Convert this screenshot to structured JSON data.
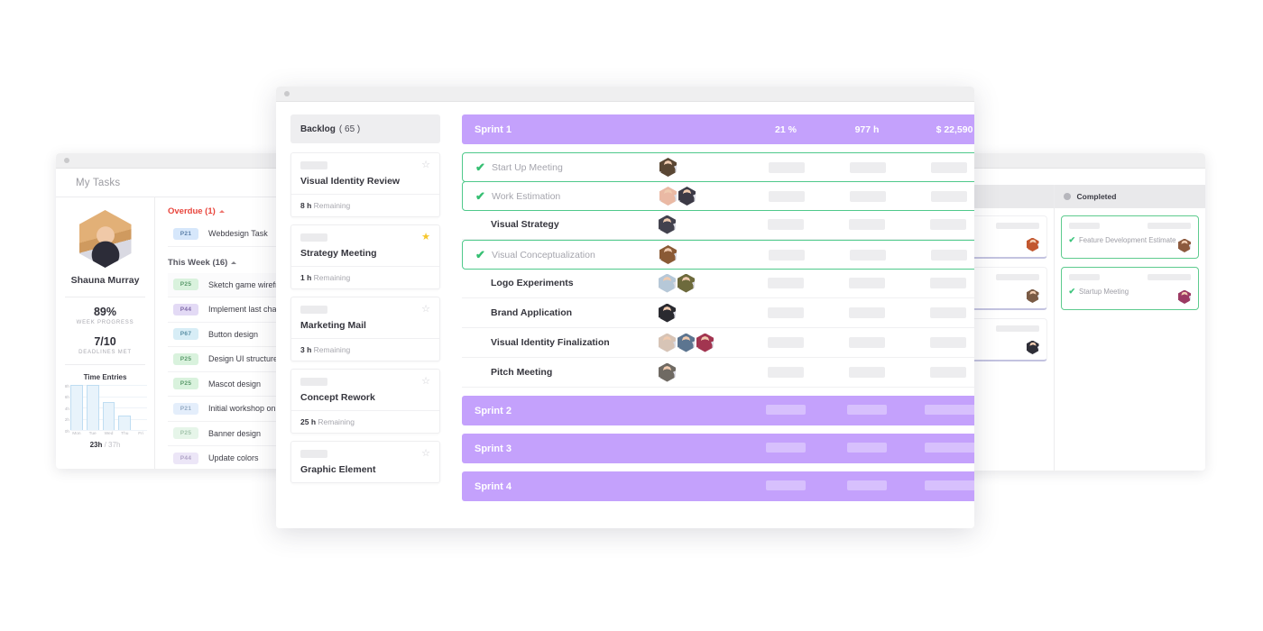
{
  "left_window": {
    "title": "My Tasks",
    "profile": {
      "name": "Shauna Murray",
      "stats": [
        {
          "value": "89%",
          "caption": "WEEK PROGRESS"
        },
        {
          "value": "7/10",
          "caption": "DEADLINES MET"
        }
      ],
      "time_total_done": "23h",
      "time_total_sep": " / ",
      "time_total_goal": "37h"
    },
    "groups": [
      {
        "label": "Overdue (1)",
        "kind": "overdue",
        "tasks": [
          {
            "tag": "P21",
            "tag_color": "#d6e7fb",
            "tag_text": "#5b7fa8",
            "name": "Webdesign Task",
            "shade": false
          }
        ]
      },
      {
        "label": "This Week (16)",
        "kind": "week",
        "tasks": [
          {
            "tag": "P25",
            "tag_color": "#d9f2dd",
            "tag_text": "#5a9a6b",
            "name": "Sketch game wireframes",
            "shade": true
          },
          {
            "tag": "P44",
            "tag_color": "#e3daf5",
            "tag_text": "#7f6aa8",
            "name": "Implement last changes",
            "shade": false
          },
          {
            "tag": "P67",
            "tag_color": "#d7edf6",
            "tag_text": "#5b90a5",
            "name": "Button design",
            "shade": false
          },
          {
            "tag": "P25",
            "tag_color": "#d9f2dd",
            "tag_text": "#5a9a6b",
            "name": "Design UI structure",
            "shade": false
          },
          {
            "tag": "P25",
            "tag_color": "#d9f2dd",
            "tag_text": "#5a9a6b",
            "name": "Mascot design",
            "shade": false
          },
          {
            "tag": "P21",
            "tag_color": "#e4eefb",
            "tag_text": "#93a9c2",
            "name": "Initial workshop on design",
            "shade": false
          },
          {
            "tag": "P25",
            "tag_color": "#e6f5e9",
            "tag_text": "#a2c4ac",
            "name": "Banner design",
            "shade": false
          },
          {
            "tag": "P44",
            "tag_color": "#ece6f7",
            "tag_text": "#b0a4c7",
            "name": "Update colors",
            "shade": false
          }
        ]
      }
    ]
  },
  "chart_data": {
    "type": "bar",
    "title": "Time Entries",
    "categories": [
      "Mon",
      "Tue",
      "Wed",
      "Thu",
      "Fri"
    ],
    "values": [
      8,
      8,
      5,
      2.5,
      0
    ],
    "ytick_labels": [
      "8h",
      "6h",
      "4h",
      "2h",
      "0h"
    ],
    "ylim": [
      0,
      8
    ],
    "xlabel": "",
    "ylabel": "",
    "grid": true,
    "legend": "none",
    "bar_fill": "#e8f3fb",
    "bar_stroke": "#bfddf2"
  },
  "center_window": {
    "backlog": {
      "title": "Backlog",
      "count": "( 65 )",
      "cards": [
        {
          "name": "Visual Identity Review",
          "hours": "8 h",
          "remaining_label": "Remaining",
          "starred": false
        },
        {
          "name": "Strategy Meeting",
          "hours": "1 h",
          "remaining_label": "Remaining",
          "starred": true
        },
        {
          "name": "Marketing Mail",
          "hours": "3 h",
          "remaining_label": "Remaining",
          "starred": false
        },
        {
          "name": "Concept Rework",
          "hours": "25 h",
          "remaining_label": "Remaining",
          "starred": false
        },
        {
          "name": "Graphic Element",
          "hours": "",
          "remaining_label": "",
          "starred": false
        }
      ]
    },
    "sprint_active": {
      "name": "Sprint 1",
      "percent": "21 %",
      "hours": "977 h",
      "budget": "$ 22,590",
      "collapse_icon": "chevron-up",
      "color": "#c4a1fc",
      "tasks": [
        {
          "name": "Start Up Meeting",
          "done": true,
          "avatars": [
            "#5a4734"
          ]
        },
        {
          "name": "Work Estimation",
          "done": true,
          "avatars": [
            "#eab9a4",
            "#3c3a46"
          ]
        },
        {
          "name": "Visual Strategy",
          "done": false,
          "avatars": [
            "#43424e"
          ]
        },
        {
          "name": "Visual Conceptualization",
          "done": true,
          "avatars": [
            "#8a5a35"
          ]
        },
        {
          "name": "Logo Experiments",
          "done": false,
          "avatars": [
            "#b6c8d8",
            "#6d6a3c"
          ]
        },
        {
          "name": "Brand Application",
          "done": false,
          "avatars": [
            "#2a2a30"
          ]
        },
        {
          "name": "Visual Identity Finalization",
          "done": false,
          "avatars": [
            "#d7c4b6",
            "#5c7590",
            "#a23550"
          ]
        },
        {
          "name": "Pitch Meeting",
          "done": false,
          "avatars": [
            "#6f6a63"
          ]
        }
      ]
    },
    "sprints_collapsed": [
      {
        "name": "Sprint 2",
        "color": "#c4a1fc",
        "collapse_icon": "chevron-down"
      },
      {
        "name": "Sprint 3",
        "color": "#c4a1fc",
        "collapse_icon": "chevron-down"
      },
      {
        "name": "Sprint 4",
        "color": "#c4a1fc",
        "collapse_icon": "chevron-down"
      }
    ]
  },
  "right_window": {
    "columns": [
      {
        "title": "",
        "dot_color": "#b6b6bc",
        "cards": [
          {
            "title": "",
            "done": false,
            "avatar": "#c2572f"
          },
          {
            "title": "",
            "done": false,
            "avatar": "#7a5b45"
          },
          {
            "title": "",
            "done": false,
            "avatar": "#2f2f38"
          }
        ]
      },
      {
        "title": "Completed",
        "dot_color": "#b6b6bc",
        "cards": [
          {
            "title": "Feature Development Estimate",
            "done": true,
            "avatar": "#8d5a3e"
          },
          {
            "title": "Startup Meeting",
            "done": true,
            "avatar": "#9c3a63"
          }
        ]
      }
    ]
  },
  "icons": {
    "check": "✔",
    "star_outline": "☆",
    "star_filled": "★",
    "chevron_up": "⌃",
    "chevron_down": "⌄"
  }
}
